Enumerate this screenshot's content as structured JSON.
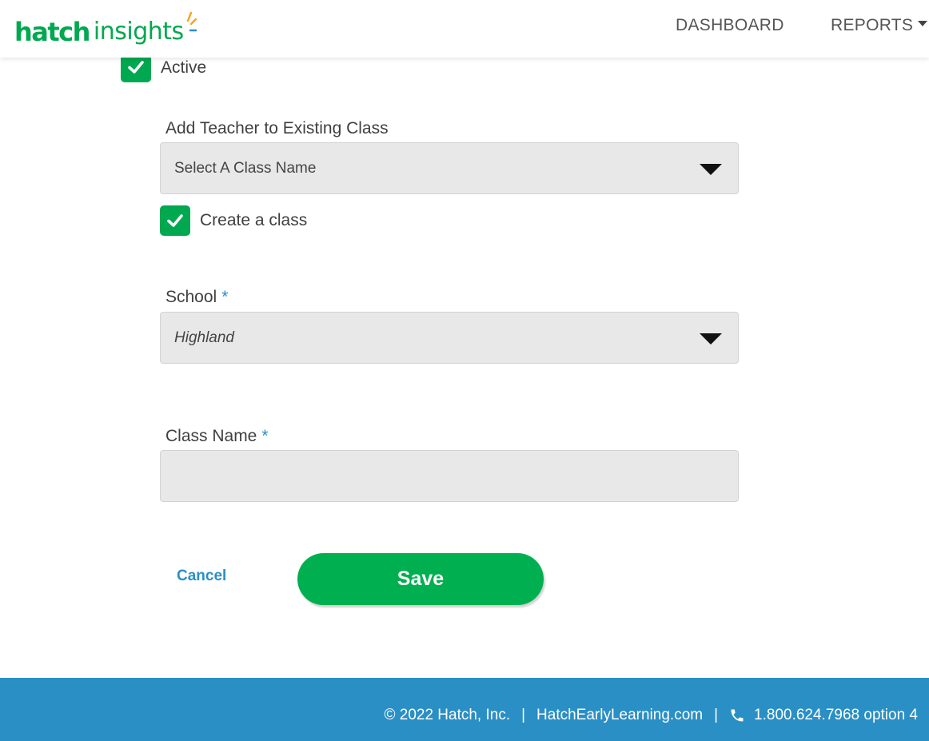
{
  "brand": {
    "logo_part1": "hatch",
    "logo_part2": "insights",
    "logo_mark": "®"
  },
  "nav": {
    "dashboard": "DASHBOARD",
    "reports": "REPORTS"
  },
  "form": {
    "active_label": "Active",
    "active_checked": true,
    "existing_class_label": "Add Teacher to Existing Class",
    "existing_class_placeholder": "Select A Class Name",
    "create_class_label": "Create a class",
    "create_class_checked": true,
    "school_label": "School",
    "school_required": "*",
    "school_value": "Highland",
    "class_name_label": "Class Name",
    "class_name_required": "*",
    "class_name_value": ""
  },
  "actions": {
    "cancel": "Cancel",
    "save": "Save"
  },
  "footer": {
    "copyright": "© 2022 Hatch, Inc.",
    "separator": "|",
    "website": "HatchEarlyLearning.com",
    "phone": "1.800.624.7968 option 4"
  },
  "colors": {
    "brand_green": "#00a84f",
    "button_green": "#00b050",
    "link_blue": "#2a8fc4",
    "footer_blue": "#2a8fc4",
    "field_gray": "#e8e8e8"
  },
  "icons": {
    "checkbox": "check-icon",
    "dropdown": "triangle-down-icon",
    "footer_phone": "phone-icon"
  }
}
